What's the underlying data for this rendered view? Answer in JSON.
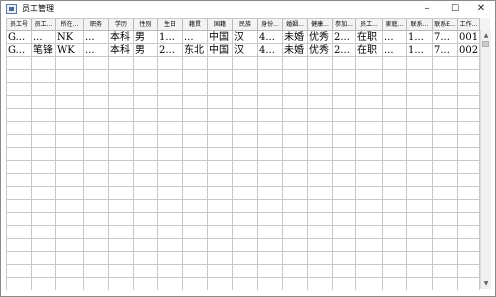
{
  "window": {
    "title": "员工管理"
  },
  "controls": {
    "minimize": "–",
    "maximize": "☐",
    "close": "✕"
  },
  "table": {
    "columns": [
      "员工号",
      "员工...",
      "所在...",
      "职务",
      "学历",
      "性别",
      "生日",
      "籍贯",
      "国籍",
      "民族",
      "身份...",
      "婚姻...",
      "健康...",
      "参加...",
      "员工...",
      "家庭...",
      "联系...",
      "联系E...",
      "工作..."
    ],
    "rows": [
      [
        "G...",
        "...",
        "NK",
        "...",
        "本科",
        "男",
        "1...",
        "...",
        "中国",
        "汉",
        "4...",
        "未婚",
        "优秀",
        "2...",
        "在职",
        "...",
        "1...",
        "7...",
        "001"
      ],
      [
        "G...",
        "笔锋",
        "WK",
        "...",
        "本科",
        "男",
        "2...",
        "东北",
        "中国",
        "汉",
        "4...",
        "未婚",
        "优秀",
        "2...",
        "在职",
        "...",
        "1...",
        "7...",
        "002"
      ]
    ],
    "empty_rows": 18
  },
  "scrollbar": {
    "up_icon": "up-arrow",
    "down_icon": "down-arrow"
  }
}
